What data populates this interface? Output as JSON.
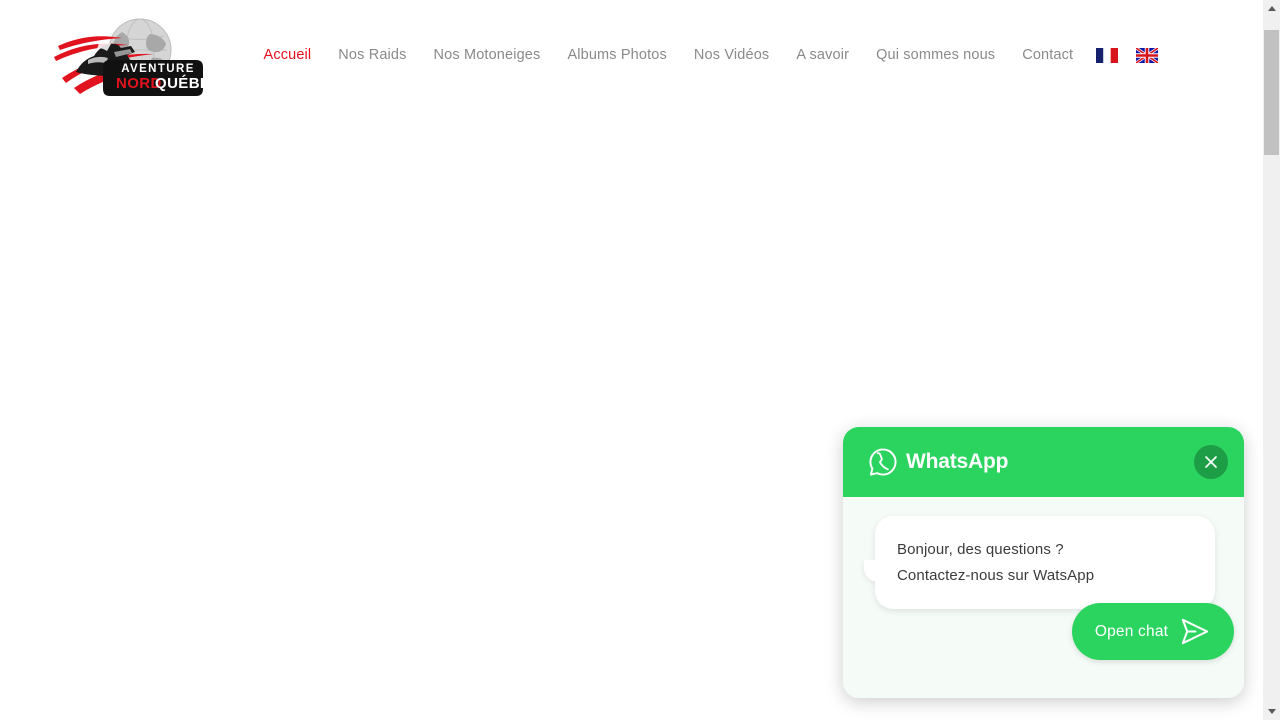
{
  "site": {
    "logo": {
      "icon": "aventure-nord-quebec-logo",
      "badge_top": "AVENTURE",
      "badge_red": "NORD",
      "badge_white": "QUÉBEC"
    },
    "nav": {
      "items": [
        {
          "label": "Accueil",
          "active": true
        },
        {
          "label": "Nos Raids",
          "active": false
        },
        {
          "label": "Nos Motoneiges",
          "active": false
        },
        {
          "label": "Albums Photos",
          "active": false
        },
        {
          "label": "Nos Vidéos",
          "active": false
        },
        {
          "label": "A savoir",
          "active": false
        },
        {
          "label": "Qui sommes nous",
          "active": false
        },
        {
          "label": "Contact",
          "active": false
        }
      ],
      "languages": [
        {
          "icon": "flag-france-icon",
          "name": "français"
        },
        {
          "icon": "flag-united-kingdom-icon",
          "name": "english"
        }
      ],
      "active_color": "#e8101c",
      "idle_color": "#8a8a8a"
    }
  },
  "whatsapp_widget": {
    "header": {
      "title": "WhatsApp",
      "logo_icon": "whatsapp-icon",
      "close_icon": "close-icon",
      "background_color": "#2bd45f",
      "close_button_color": "#1d9e46"
    },
    "message": {
      "line1": "Bonjour, des questions ?",
      "line2": "Contactez-nous sur WatsApp"
    },
    "open_chat": {
      "label": "Open chat",
      "icon": "send-paper-plane-icon",
      "background_color": "#2bd45f"
    },
    "body_background_color": "#f5fbf7"
  },
  "scrollbar": {
    "up_icon": "scroll-up-arrow-icon",
    "down_icon": "scroll-down-arrow-icon",
    "thumb": "scrollbar-thumb"
  }
}
